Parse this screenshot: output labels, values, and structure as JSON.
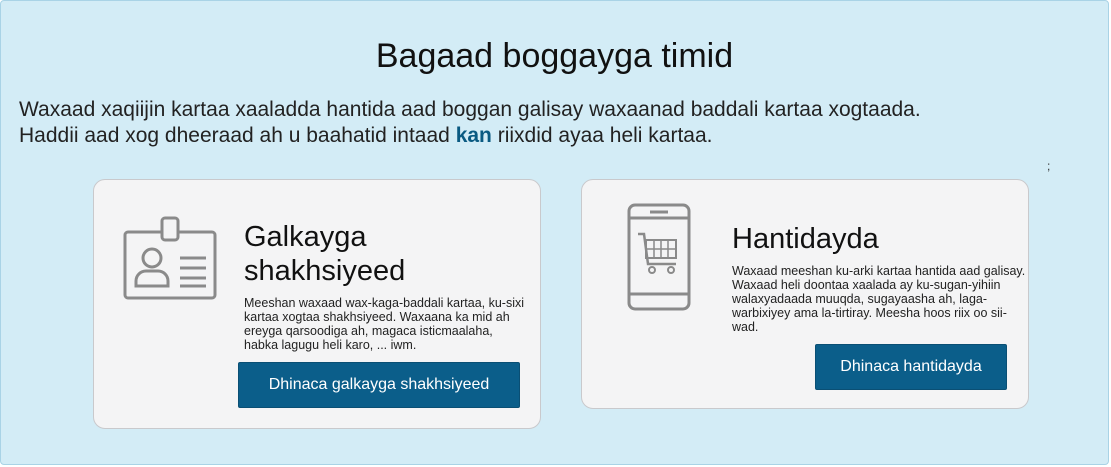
{
  "page": {
    "title": "Bagaad boggayga timid",
    "intro_line1": "Waxaad xaqiijin kartaa xaaladda hantida aad boggan galisay waxaanad baddali kartaa xogtaada.",
    "intro_line2_before": "Haddii aad xog dheeraad ah u baahatid intaad ",
    "intro_link": "kan",
    "intro_line2_after": " riixdid ayaa heli kartaa.",
    "stray_mark": ";"
  },
  "cards": [
    {
      "title": "Galkayga shakhsiyeed",
      "description": "Meeshan waxaad wax-kaga-baddali kartaa, ku-sixi kartaa xogtaa shakhsiyeed. Waxaana ka mid ah ereyga qarsoodiga ah, magaca isticmaalaha, habka lagugu heli karo, ... iwm.",
      "button_label": "Dhinaca galkayga shakhsiyeed",
      "icon": "id-badge-icon"
    },
    {
      "title": "Hantidayda",
      "description": "Waxaad meeshan ku-arki kartaa hantida aad galisay. Waxaad heli doontaa xaalada ay ku-sugan-yihiin walaxyadaada muuqda, sugayaasha ah, laga-warbixiyey ama la-tirtiray. Meesha hoos riix oo sii-wad.",
      "button_label": "Dhinaca hantidayda",
      "icon": "mobile-cart-icon"
    }
  ],
  "colors": {
    "panel_bg": "#d3ecf6",
    "card_bg": "#f4f4f5",
    "button_bg": "#0b5e8a",
    "link": "#0a5a82",
    "icon_stroke": "#8a8a8a"
  }
}
